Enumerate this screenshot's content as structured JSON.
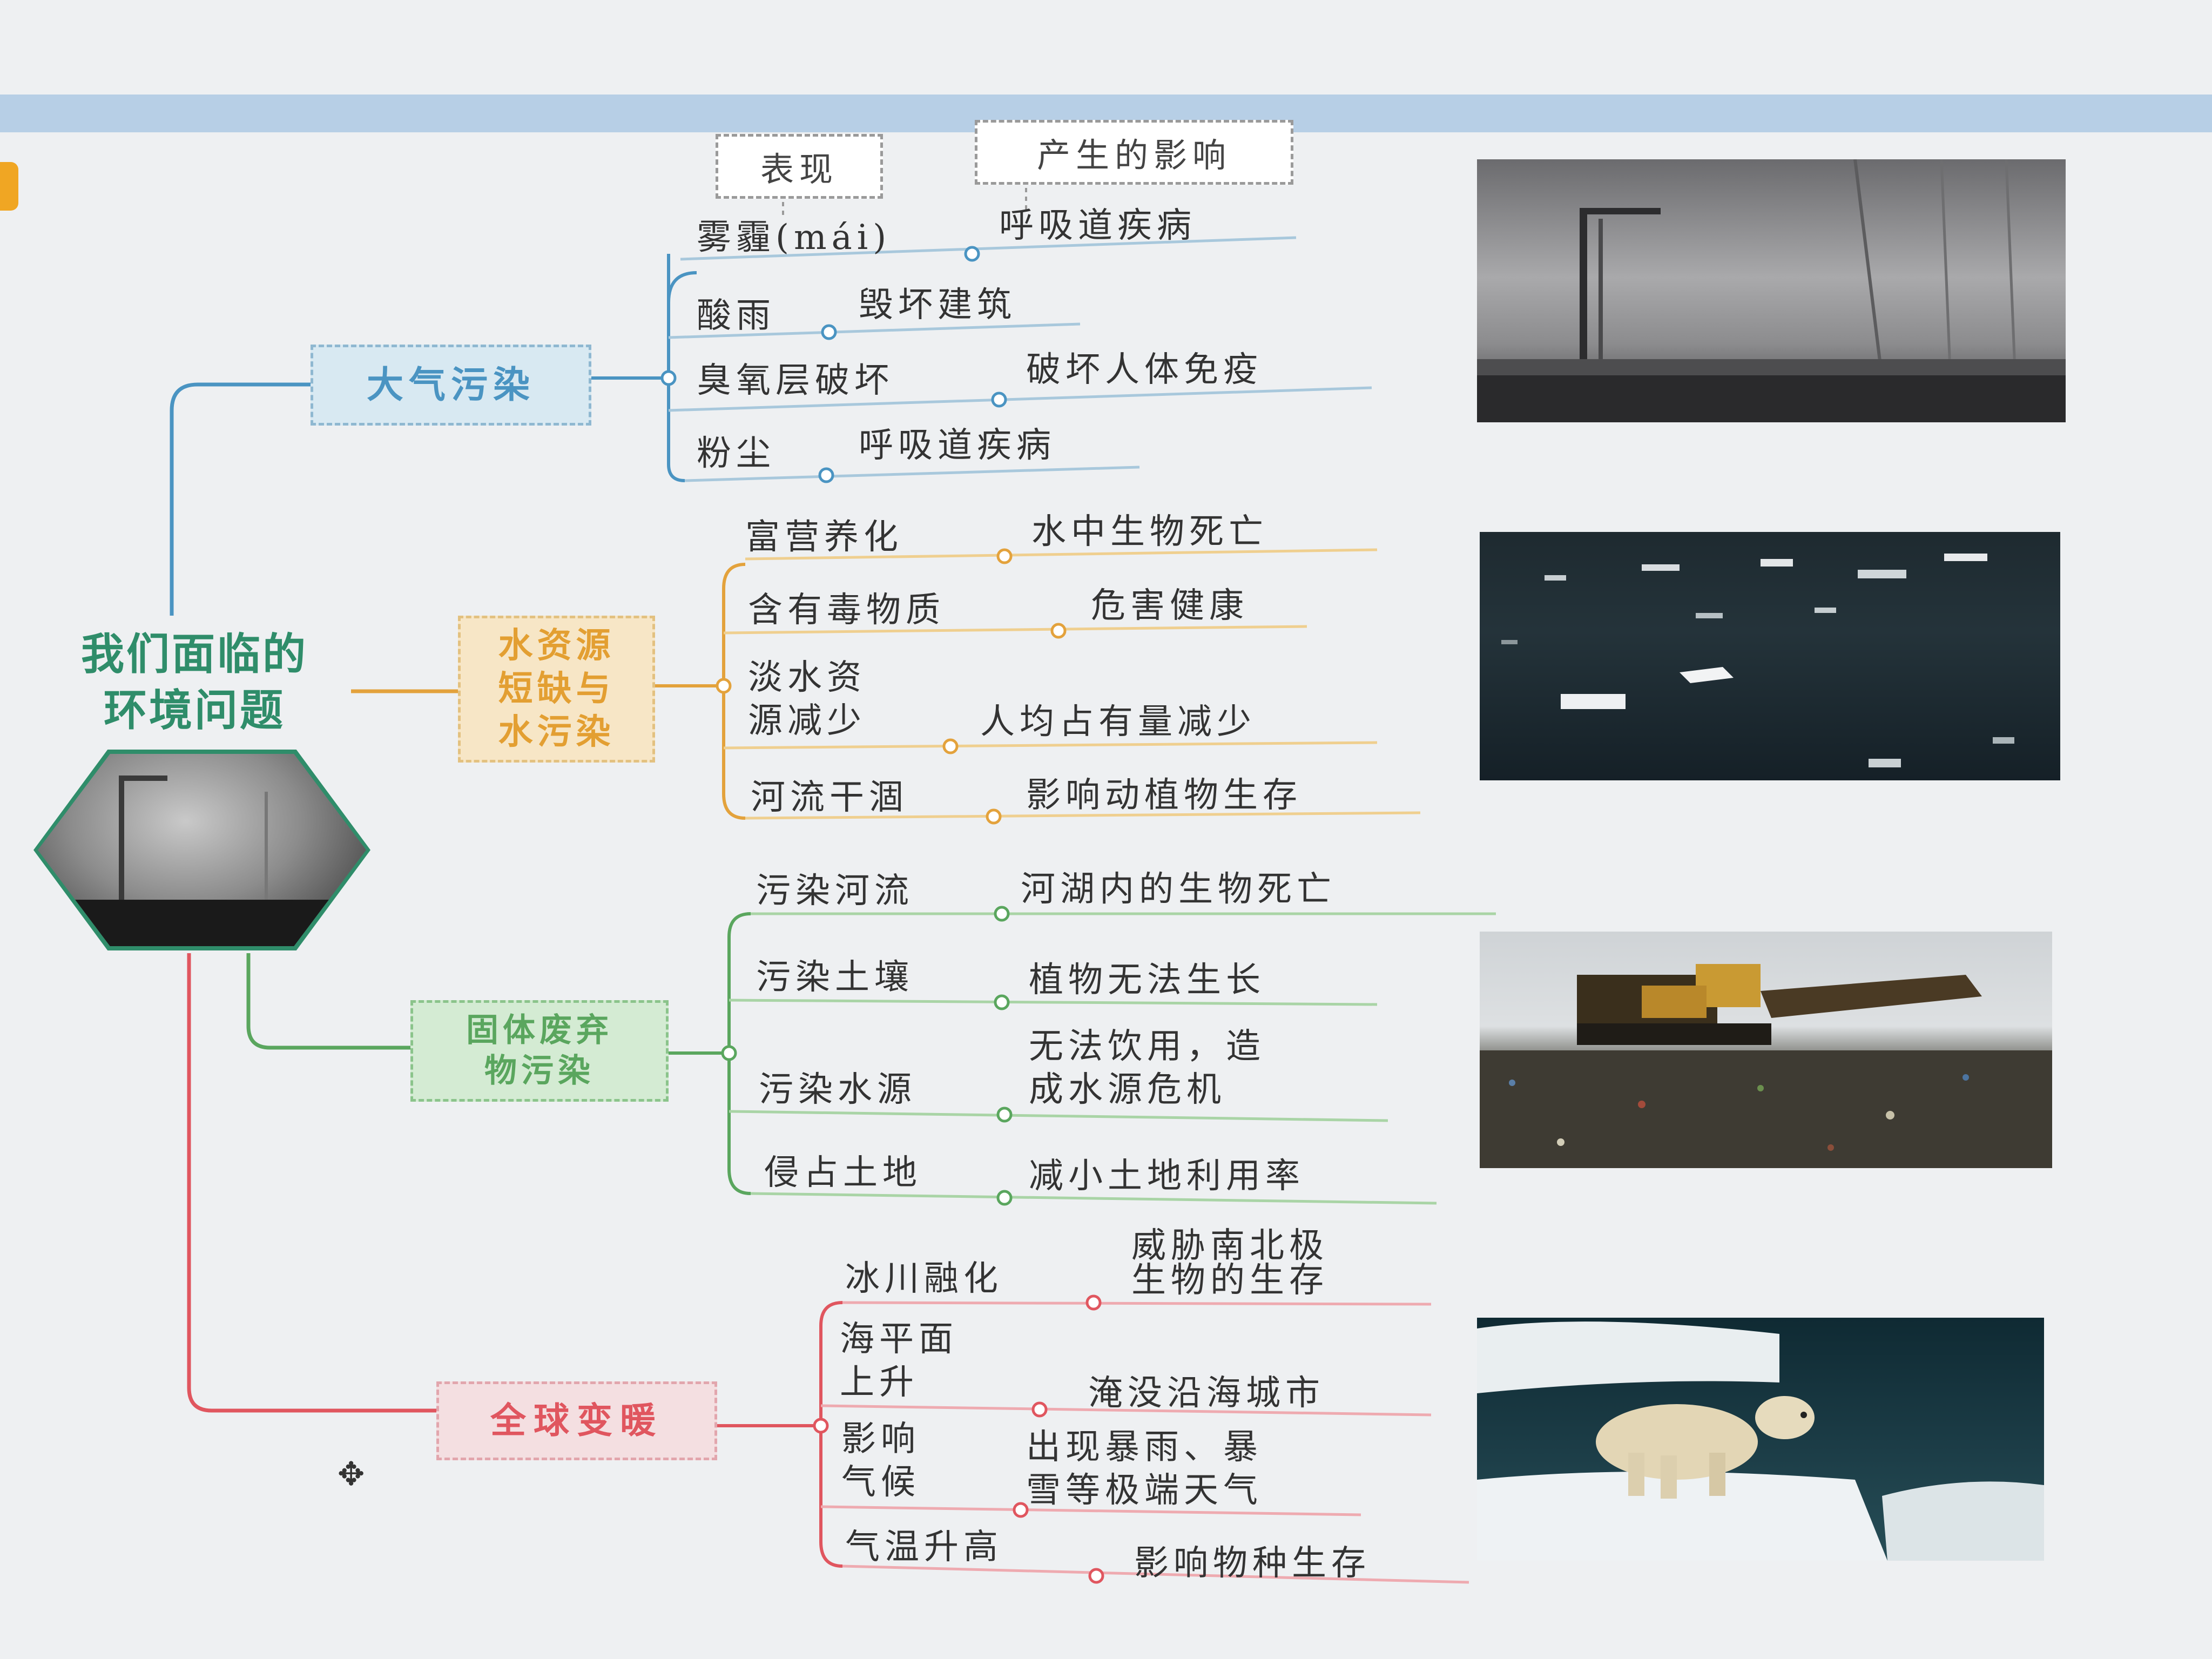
{
  "central": {
    "line1": "我们面临的",
    "line2": "环境问题"
  },
  "headers": {
    "manifestation": "表现",
    "impact": "产生的影响"
  },
  "branches": {
    "air": {
      "label": "大气污染",
      "items": [
        {
          "cause": "雾霾(mái)",
          "effect": "呼吸道疾病"
        },
        {
          "cause": "酸雨",
          "effect": "毁坏建筑"
        },
        {
          "cause": "臭氧层破坏",
          "effect": "破坏人体免疫"
        },
        {
          "cause": "粉尘",
          "effect": "呼吸道疾病"
        }
      ]
    },
    "water": {
      "label_lines": [
        "水资源",
        "短缺与",
        "水污染"
      ],
      "items": [
        {
          "cause": "富营养化",
          "effect": "水中生物死亡"
        },
        {
          "cause": "含有毒物质",
          "effect": "危害健康"
        },
        {
          "cause_lines": [
            "淡水资",
            "源减少"
          ],
          "effect": "人均占有量减少"
        },
        {
          "cause": "河流干涸",
          "effect": "影响动植物生存"
        }
      ]
    },
    "solid": {
      "label_lines": [
        "固体废弃",
        "物污染"
      ],
      "items": [
        {
          "cause": "污染河流",
          "effect": "河湖内的生物死亡"
        },
        {
          "cause": "污染土壤",
          "effect": "植物无法生长"
        },
        {
          "cause": "污染水源",
          "effect_lines": [
            "无法饮用，造",
            "成水源危机"
          ]
        },
        {
          "cause": "侵占土地",
          "effect": "减小土地利用率"
        }
      ]
    },
    "global": {
      "label": "全球变暖",
      "items": [
        {
          "cause": "冰川融化",
          "effect_lines": [
            "威胁南北极",
            "生物的生存"
          ]
        },
        {
          "cause_lines": [
            "海平面",
            "上升"
          ],
          "effect": "淹没沿海城市"
        },
        {
          "cause_lines": [
            "影响",
            "气候"
          ],
          "effect_lines": [
            "出现暴雨、暴",
            "雪等极端天气"
          ]
        },
        {
          "cause": "气温升高",
          "effect": "影响物种生存"
        }
      ]
    }
  },
  "photos": [
    "smog-bridge-photo",
    "polluted-water-photo",
    "landfill-bulldozer-photo",
    "polar-bear-ice-photo"
  ],
  "colors": {
    "air": "#4a94c2",
    "water": "#e3a23c",
    "solid": "#5aa65e",
    "global": "#e0565f",
    "central": "#2f8d6a"
  }
}
